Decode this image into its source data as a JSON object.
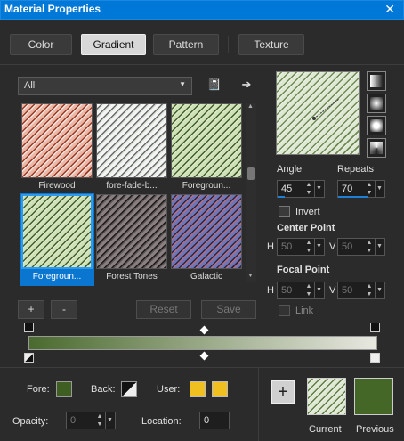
{
  "window": {
    "title": "Material Properties",
    "close_label": "✕"
  },
  "tabs": [
    {
      "label": "Color"
    },
    {
      "label": "Gradient"
    },
    {
      "label": "Pattern"
    },
    {
      "label": "Texture"
    }
  ],
  "category": {
    "selected": "All"
  },
  "icons": {
    "book": "📓",
    "arrow": "➔"
  },
  "gradients": [
    {
      "label": "Firewood"
    },
    {
      "label": "fore-fade-b..."
    },
    {
      "label": "Foregroun..."
    },
    {
      "label": "Foregroun..."
    },
    {
      "label": "Forest Tones"
    },
    {
      "label": "Galactic"
    }
  ],
  "buttons": {
    "add": "+",
    "remove": "-",
    "reset": "Reset",
    "save": "Save",
    "add_to_swatches": "+"
  },
  "settings": {
    "angle_label": "Angle",
    "angle_value": "45",
    "repeats_label": "Repeats",
    "repeats_value": "70",
    "invert_label": "Invert",
    "center_label": "Center Point",
    "center_h_label": "H",
    "center_h": "50",
    "center_v_label": "V",
    "center_v": "50",
    "focal_label": "Focal Point",
    "focal_h_label": "H",
    "focal_h": "50",
    "focal_v_label": "V",
    "focal_v": "50",
    "link_label": "Link"
  },
  "bottom": {
    "fore_label": "Fore:",
    "back_label": "Back:",
    "user_label": "User:",
    "opacity_label": "Opacity:",
    "opacity_value": "0",
    "location_label": "Location:",
    "location_value": "0",
    "current_label": "Current",
    "previous_label": "Previous"
  },
  "colors": {
    "accent": "#0078d7",
    "fore": "#3e5e22",
    "user": "#f0c020",
    "previous": "#446626"
  }
}
